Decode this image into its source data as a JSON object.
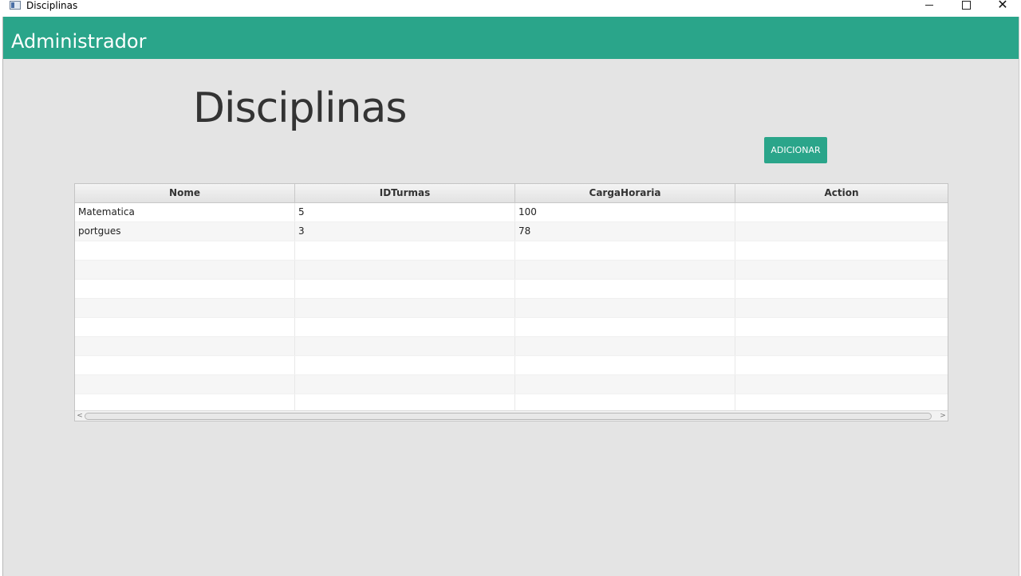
{
  "window": {
    "title": "Disciplinas",
    "minimize_glyph": "–",
    "maximize_glyph": "☐",
    "close_glyph": "✕"
  },
  "header": {
    "title": "Administrador",
    "color": "#2aa58a"
  },
  "main": {
    "page_title": "Disciplinas",
    "add_button_label": "ADICIONAR"
  },
  "table": {
    "columns": [
      "Nome",
      "IDTurmas",
      "CargaHoraria",
      "Action"
    ],
    "rows": [
      [
        "Matematica",
        "5",
        "100",
        ""
      ],
      [
        "portgues",
        "3",
        "78",
        ""
      ],
      [
        "",
        "",
        "",
        ""
      ],
      [
        "",
        "",
        "",
        ""
      ],
      [
        "",
        "",
        "",
        ""
      ],
      [
        "",
        "",
        "",
        ""
      ],
      [
        "",
        "",
        "",
        ""
      ],
      [
        "",
        "",
        "",
        ""
      ],
      [
        "",
        "",
        "",
        ""
      ],
      [
        "",
        "",
        "",
        ""
      ],
      [
        "",
        "",
        "",
        ""
      ]
    ]
  },
  "scrollbar": {
    "left_glyph": "<",
    "right_glyph": ">"
  },
  "icons": {
    "app_icon": "window-app-icon",
    "minimize": "minimize-icon",
    "maximize": "maximize-icon",
    "close": "close-icon"
  }
}
